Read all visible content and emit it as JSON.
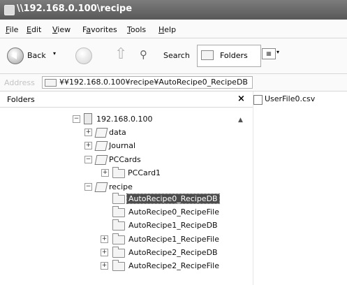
{
  "window": {
    "title": "\\\\192.168.0.100\\recipe"
  },
  "menu": [
    {
      "label": "File",
      "ul": "F",
      "rest": "ile"
    },
    {
      "label": "Edit",
      "ul": "E",
      "rest": "dit"
    },
    {
      "label": "View",
      "ul": "V",
      "rest": "iew"
    },
    {
      "label": "Favorites",
      "ul": "a",
      "pre": "F",
      "rest": "vorites"
    },
    {
      "label": "Tools",
      "ul": "T",
      "rest": "ools"
    },
    {
      "label": "Help",
      "ul": "H",
      "rest": "elp"
    }
  ],
  "toolbar": {
    "back_label": "Back",
    "search_label": "Search",
    "folders_label": "Folders"
  },
  "address": {
    "label": "Address",
    "value": "¥¥192.168.0.100¥recipe¥AutoRecipe0_RecipeDB"
  },
  "folders_pane": {
    "title": "Folders",
    "close": "×"
  },
  "tree": {
    "root": "192.168.0.100",
    "data": "data",
    "journal": "Journal",
    "pccards": "PCCards",
    "pccard1": "PCCard1",
    "recipe": "recipe",
    "items": [
      "AutoRecipe0_RecipeDB",
      "AutoRecipe0_RecipeFile",
      "AutoRecipe1_RecipeDB",
      "AutoRecipe1_RecipeFile",
      "AutoRecipe2_RecipeDB",
      "AutoRecipe2_RecipeFile"
    ]
  },
  "files": [
    {
      "name": "UserFile0.csv"
    }
  ]
}
